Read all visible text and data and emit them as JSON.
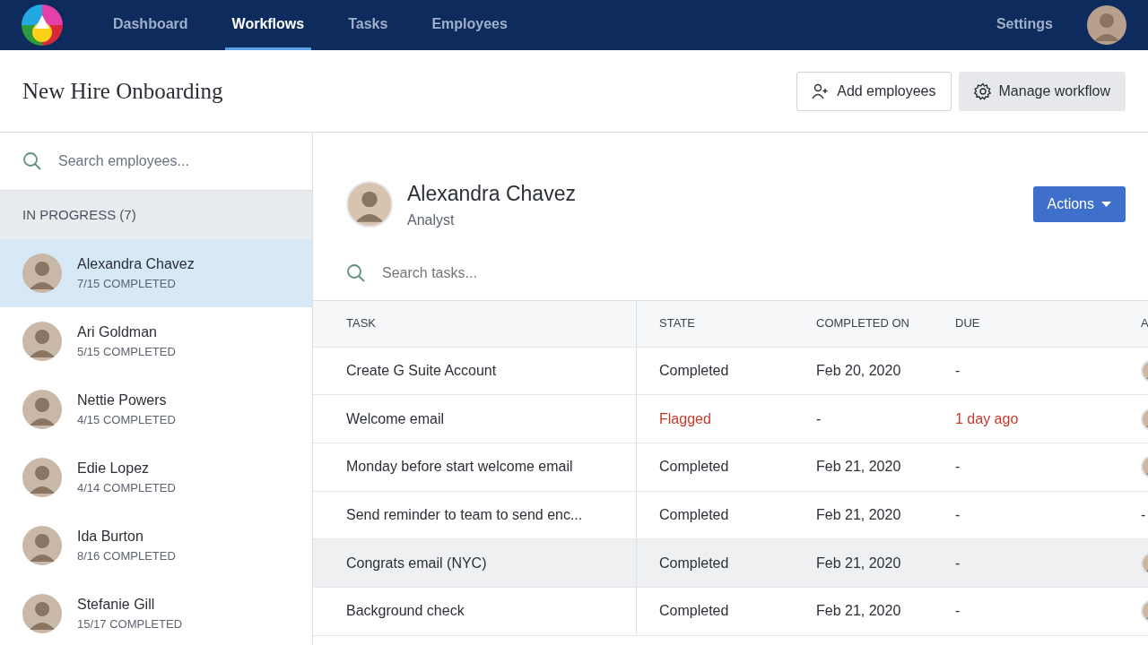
{
  "nav": {
    "tabs": [
      {
        "label": "Dashboard",
        "selected": false
      },
      {
        "label": "Workflows",
        "selected": true
      },
      {
        "label": "Tasks",
        "selected": false
      },
      {
        "label": "Employees",
        "selected": false
      }
    ],
    "settings": "Settings"
  },
  "page": {
    "title": "New Hire Onboarding",
    "buttons": [
      {
        "label": "Add employees",
        "kind": "add"
      },
      {
        "label": "Manage workflow",
        "kind": "manage"
      }
    ]
  },
  "sidebar": {
    "search": {
      "placeholder": "Search employees..."
    },
    "group": "IN PROGRESS (7)",
    "employees": [
      {
        "name": "Alexandra Chavez",
        "progress": "7/15 COMPLETED",
        "selected": true
      },
      {
        "name": "Ari Goldman",
        "progress": "5/15 COMPLETED",
        "selected": false
      },
      {
        "name": "Nettie Powers",
        "progress": "4/15 COMPLETED",
        "selected": false
      },
      {
        "name": "Edie Lopez",
        "progress": "4/14 COMPLETED",
        "selected": false
      },
      {
        "name": "Ida Burton",
        "progress": "8/16 COMPLETED",
        "selected": false
      },
      {
        "name": "Stefanie Gill",
        "progress": "15/17 COMPLETED",
        "selected": false
      }
    ]
  },
  "detail": {
    "name": "Alexandra Chavez",
    "role": "Analyst",
    "actions": "Actions",
    "search": {
      "placeholder": "Search tasks..."
    },
    "table": {
      "columns": [
        "TASK",
        "STATE",
        "COMPLETED ON",
        "DUE",
        "A"
      ],
      "rows": [
        {
          "task": "Create G Suite Account",
          "state": "Completed",
          "completed_on": "Feb 20, 2020",
          "due": "-",
          "flagged": false,
          "hovered": false,
          "assignee": {
            "kind": "avatar"
          }
        },
        {
          "task": "Welcome email",
          "state": "Flagged",
          "completed_on": "-",
          "due": "1 day ago",
          "flagged": true,
          "hovered": false,
          "assignee": {
            "kind": "avatar"
          }
        },
        {
          "task": "Monday before start welcome email",
          "state": "Completed",
          "completed_on": "Feb 21, 2020",
          "due": "-",
          "flagged": false,
          "hovered": false,
          "assignee": {
            "kind": "avatar"
          }
        },
        {
          "task": "Send reminder to team to send enc...",
          "state": "Completed",
          "completed_on": "Feb 21, 2020",
          "due": "-",
          "flagged": false,
          "hovered": false,
          "assignee": {
            "kind": "text",
            "text": "-"
          }
        },
        {
          "task": "Congrats email (NYC)",
          "state": "Completed",
          "completed_on": "Feb 21, 2020",
          "due": "-",
          "flagged": false,
          "hovered": true,
          "assignee": {
            "kind": "avatar"
          }
        },
        {
          "task": "Background check",
          "state": "Completed",
          "completed_on": "Feb 21, 2020",
          "due": "-",
          "flagged": false,
          "hovered": false,
          "assignee": {
            "kind": "avatar"
          }
        }
      ]
    }
  }
}
